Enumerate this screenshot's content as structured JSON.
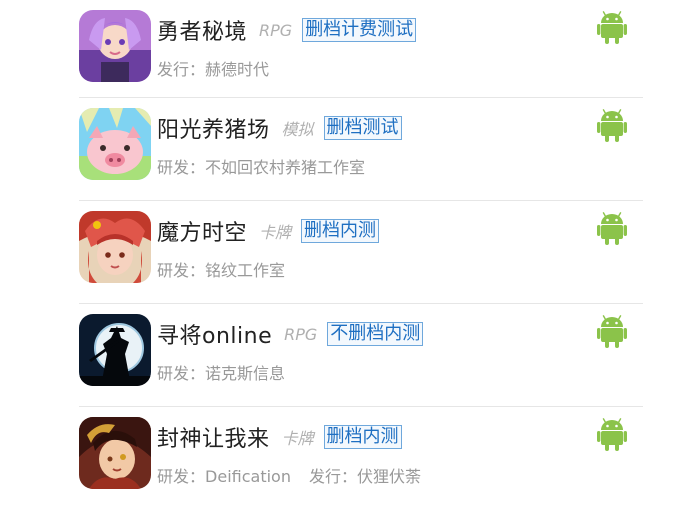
{
  "accent_color": "#1e6fc2",
  "android_color": "#8bc34a",
  "games": [
    {
      "name": "勇者秘境",
      "genre": "RPG",
      "test_type": "删档计费测试",
      "meta": [
        {
          "label": "发行",
          "value": "赫德时代"
        }
      ],
      "platform_icon": "android-icon"
    },
    {
      "name": "阳光养猪场",
      "genre": "模拟",
      "test_type": "删档测试",
      "meta": [
        {
          "label": "研发",
          "value": "不如回农村养猪工作室"
        }
      ],
      "platform_icon": "android-icon"
    },
    {
      "name": "魔方时空",
      "genre": "卡牌",
      "test_type": "删档内测",
      "meta": [
        {
          "label": "研发",
          "value": "铭纹工作室"
        }
      ],
      "platform_icon": "android-icon"
    },
    {
      "name": "寻将online",
      "genre": "RPG",
      "test_type": "不删档内测",
      "meta": [
        {
          "label": "研发",
          "value": "诺克斯信息"
        }
      ],
      "platform_icon": "android-icon"
    },
    {
      "name": "封神让我来",
      "genre": "卡牌",
      "test_type": "删档内测",
      "meta": [
        {
          "label": "研发",
          "value": "Deification"
        },
        {
          "label": "发行",
          "value": "伏狸伏荼"
        }
      ],
      "platform_icon": "android-icon"
    }
  ]
}
